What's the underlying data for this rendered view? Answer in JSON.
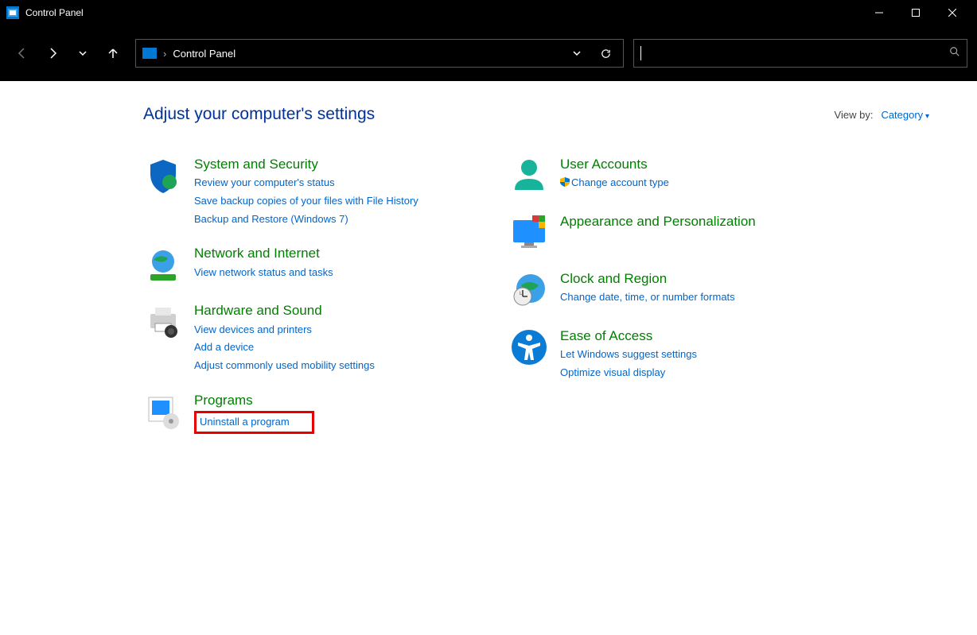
{
  "window": {
    "title": "Control Panel"
  },
  "address": {
    "location": "Control Panel"
  },
  "header": {
    "title": "Adjust your computer's settings",
    "view_by_label": "View by:",
    "view_by_value": "Category"
  },
  "left_col": {
    "system": {
      "title": "System and Security",
      "l1": "Review your computer's status",
      "l2": "Save backup copies of your files with File History",
      "l3": "Backup and Restore (Windows 7)"
    },
    "network": {
      "title": "Network and Internet",
      "l1": "View network status and tasks"
    },
    "hardware": {
      "title": "Hardware and Sound",
      "l1": "View devices and printers",
      "l2": "Add a device",
      "l3": "Adjust commonly used mobility settings"
    },
    "programs": {
      "title": "Programs",
      "l1": "Uninstall a program"
    }
  },
  "right_col": {
    "users": {
      "title": "User Accounts",
      "l1": "Change account type"
    },
    "appearance": {
      "title": "Appearance and Personalization"
    },
    "clock": {
      "title": "Clock and Region",
      "l1": "Change date, time, or number formats"
    },
    "ease": {
      "title": "Ease of Access",
      "l1": "Let Windows suggest settings",
      "l2": "Optimize visual display"
    }
  }
}
